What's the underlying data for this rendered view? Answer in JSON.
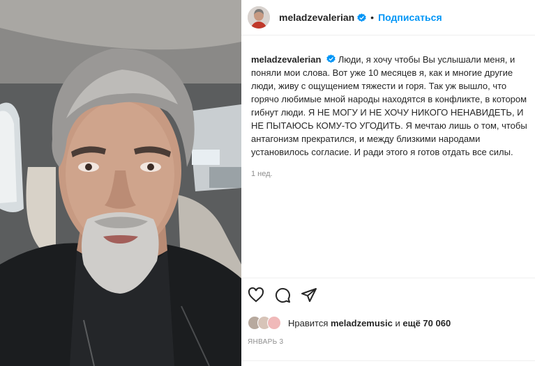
{
  "header": {
    "username": "meladzevalerian",
    "separator": "•",
    "follow_label": "Подписаться"
  },
  "caption": {
    "username": "meladzevalerian",
    "text": "Люди, я хочу чтобы Вы услышали меня, и поняли мои слова. Вот уже 10 месяцев я, как и многие другие люди, живу с ощущением тяжести и горя. Так уж вышло, что горячо любимые мной народы находятся в конфликте, в котором гибнут люди. Я НЕ МОГУ И НЕ ХОЧУ НИКОГО НЕНАВИДЕТЬ, И НЕ ПЫТАЮСЬ КОМУ-ТО УГОДИТЬ. Я мечтаю лишь о том, чтобы антагонизм прекратился, и между близкими народами установилось согласие. И ради этого я готов отдать все силы.",
    "time": "1 нед."
  },
  "likes": {
    "prefix": "Нравится",
    "liker": "meladzemusic",
    "conjunction": "и",
    "others": "ещё 70 060"
  },
  "date": "ЯНВАРЬ 3",
  "icons": [
    "verified-badge-icon",
    "heart-icon",
    "comment-icon",
    "share-icon"
  ],
  "colors": {
    "accent": "#0095f6",
    "text": "#262626",
    "muted": "#8e8e8e"
  }
}
